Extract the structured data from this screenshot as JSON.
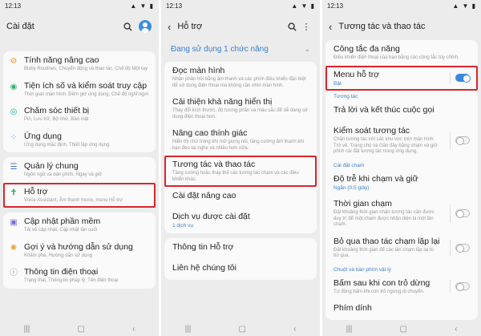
{
  "status": {
    "time": "12:13",
    "icons": "▲ ▼ ▮"
  },
  "screen1": {
    "title": "Cài đặt",
    "items": [
      {
        "label": "Tính năng nâng cao",
        "sub": "Bixby Routines, Chuyển động và thao tác, Chế độ Một tay"
      },
      {
        "label": "Tiện ích số và kiểm soát truy cập",
        "sub": "Thời gian màn hình, Đếm giờ ứng dụng, Chế độ nghỉ ngơi"
      },
      {
        "label": "Chăm sóc thiết bị",
        "sub": "Pin, Lưu trữ, Bộ nhớ, Bảo mật"
      },
      {
        "label": "Ứng dụng",
        "sub": "Ứng dụng mặc định, Thiết lập ứng dụng"
      },
      {
        "label": "Quản lý chung",
        "sub": "Ngôn ngữ và bàn phím, Ngày và giờ"
      },
      {
        "label": "Hỗ trợ",
        "sub": "Voice Assistant, Âm thanh mono, menu Hỗ trợ"
      },
      {
        "label": "Cập nhật phần mềm",
        "sub": "Tải về cập nhật, Cập nhật lần cuối"
      },
      {
        "label": "Gợi ý và hướng dẫn sử dụng",
        "sub": "Khám phá, Hướng dẫn sử dụng"
      },
      {
        "label": "Thông tin điện thoại",
        "sub": "Trạng thái, Thông tin pháp lý, Tên điện thoại"
      }
    ]
  },
  "screen2": {
    "title": "Hỗ trợ",
    "dropdown": "Đang sử dụng 1 chức năng",
    "items": [
      {
        "label": "Đọc màn hình",
        "sub": "Nhận phản hồi bằng âm thanh và các phím điều khiển đặc biệt để sử dụng điện thoại mà không cần nhìn màn hình."
      },
      {
        "label": "Cải thiện khả năng hiển thị",
        "sub": "Thay đổi kích thước, độ tương phản và màu sắc để dễ dàng sử dụng điện thoại hơn."
      },
      {
        "label": "Nâng cao thính giác",
        "sub": "Hiển thị chữ trong khi mở giọng nói, tăng cường âm thanh khi bạn đeo tai nghe và nhiều hơn nữa."
      },
      {
        "label": "Tương tác và thao tác",
        "sub": "Tăng cường hoặc thay thế các tương tác chạm và các điều khiển khác."
      },
      {
        "label": "Cài đặt nâng cao",
        "sub": ""
      },
      {
        "label": "Dịch vụ được cài đặt",
        "sub": "1 dịch vụ"
      },
      {
        "label": "Thông tin Hỗ trợ",
        "sub": ""
      },
      {
        "label": "Liên hệ chúng tôi",
        "sub": ""
      }
    ]
  },
  "screen3": {
    "title": "Tương tác và thao tác",
    "item_multi": {
      "label": "Công tắc đa năng",
      "sub": "Điều khiển điện thoại của bạn bằng các công tắc tùy chỉnh."
    },
    "item_menu": {
      "label": "Menu hỗ trợ",
      "sub": "Bật"
    },
    "section_interaction": "Tương tác",
    "item_answer": {
      "label": "Trả lời và kết thúc cuộc gọi"
    },
    "item_control": {
      "label": "Kiểm soát tương tác",
      "sub": "Chặn tương tác với các khu vực trên màn hình. Trở về, Trang chủ và Gần đây bằng chạm và giữ phím cài đặt tương tác trong ứng dụng."
    },
    "section_touch": "Cài đặt chạm",
    "item_delay": {
      "label": "Độ trễ khi chạm và giữ",
      "sub": "Ngắn (0,5 giây)"
    },
    "item_time": {
      "label": "Thời gian chạm",
      "sub": "Đặt khoảng thời gian nhận tương tác cần được duy trì để một chạm được nhận diện là một lần chạm."
    },
    "item_ignore": {
      "label": "Bỏ qua thao tác chạm lặp lại",
      "sub": "Đặt khoảng thời gian để các lần chạm lặp lại bị bỏ qua."
    },
    "section_mouse": "Chuột và bàn phím vật lý",
    "item_click": {
      "label": "Bấm sau khi con trỏ dừng",
      "sub": "Tự động bấm khi con trỏ ngừng di chuyển."
    },
    "item_partial": {
      "label": "Phím dính"
    }
  },
  "colors": {
    "highlight": "#d9262e",
    "accent": "#3a86e3"
  }
}
